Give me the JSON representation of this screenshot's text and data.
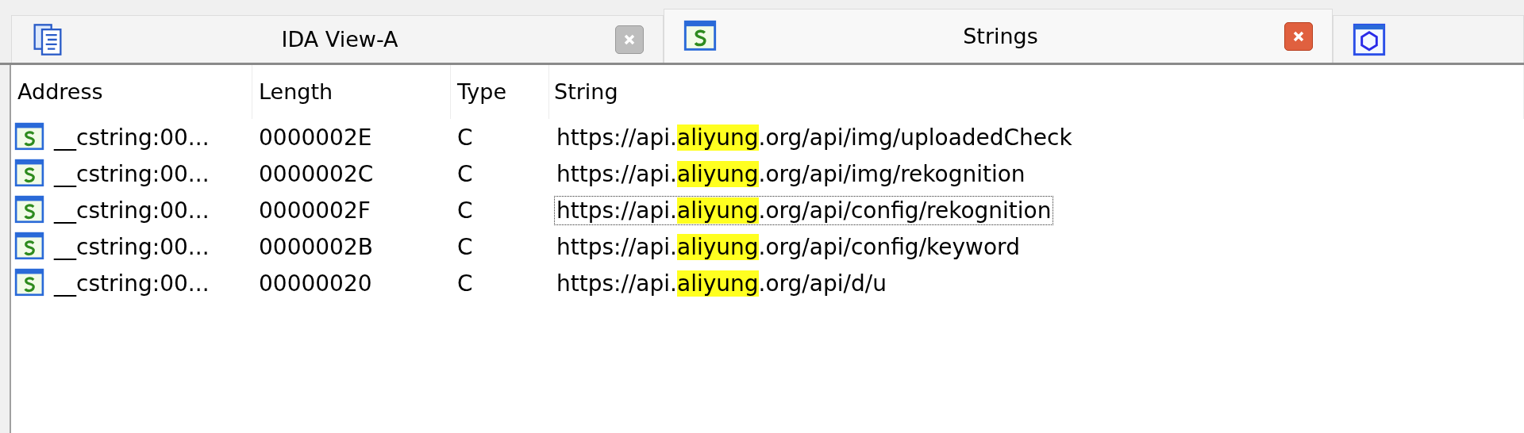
{
  "tabs": [
    {
      "label": "IDA View-A",
      "selected": false
    },
    {
      "label": "Strings",
      "selected": true
    },
    {
      "selected": false
    }
  ],
  "table": {
    "columns": [
      "Address",
      "Length",
      "Type",
      "String"
    ],
    "rows": [
      {
        "address": "__cstring:00...",
        "length": "0000002E",
        "type": "C",
        "prefix": "https://api.",
        "match": "aliyung",
        "suffix": ".org/api/img/uploadedCheck",
        "focused": false
      },
      {
        "address": "__cstring:00...",
        "length": "0000002C",
        "type": "C",
        "prefix": "https://api.",
        "match": "aliyung",
        "suffix": ".org/api/img/rekognition",
        "focused": false
      },
      {
        "address": "__cstring:00...",
        "length": "0000002F",
        "type": "C",
        "prefix": "https://api.",
        "match": "aliyung",
        "suffix": ".org/api/config/rekognition",
        "focused": true
      },
      {
        "address": "__cstring:00...",
        "length": "0000002B",
        "type": "C",
        "prefix": "https://api.",
        "match": "aliyung",
        "suffix": ".org/api/config/keyword",
        "focused": false
      },
      {
        "address": "__cstring:00...",
        "length": "00000020",
        "type": "C",
        "prefix": "https://api.",
        "match": "aliyung",
        "suffix": ".org/api/d/u",
        "focused": false
      }
    ]
  }
}
